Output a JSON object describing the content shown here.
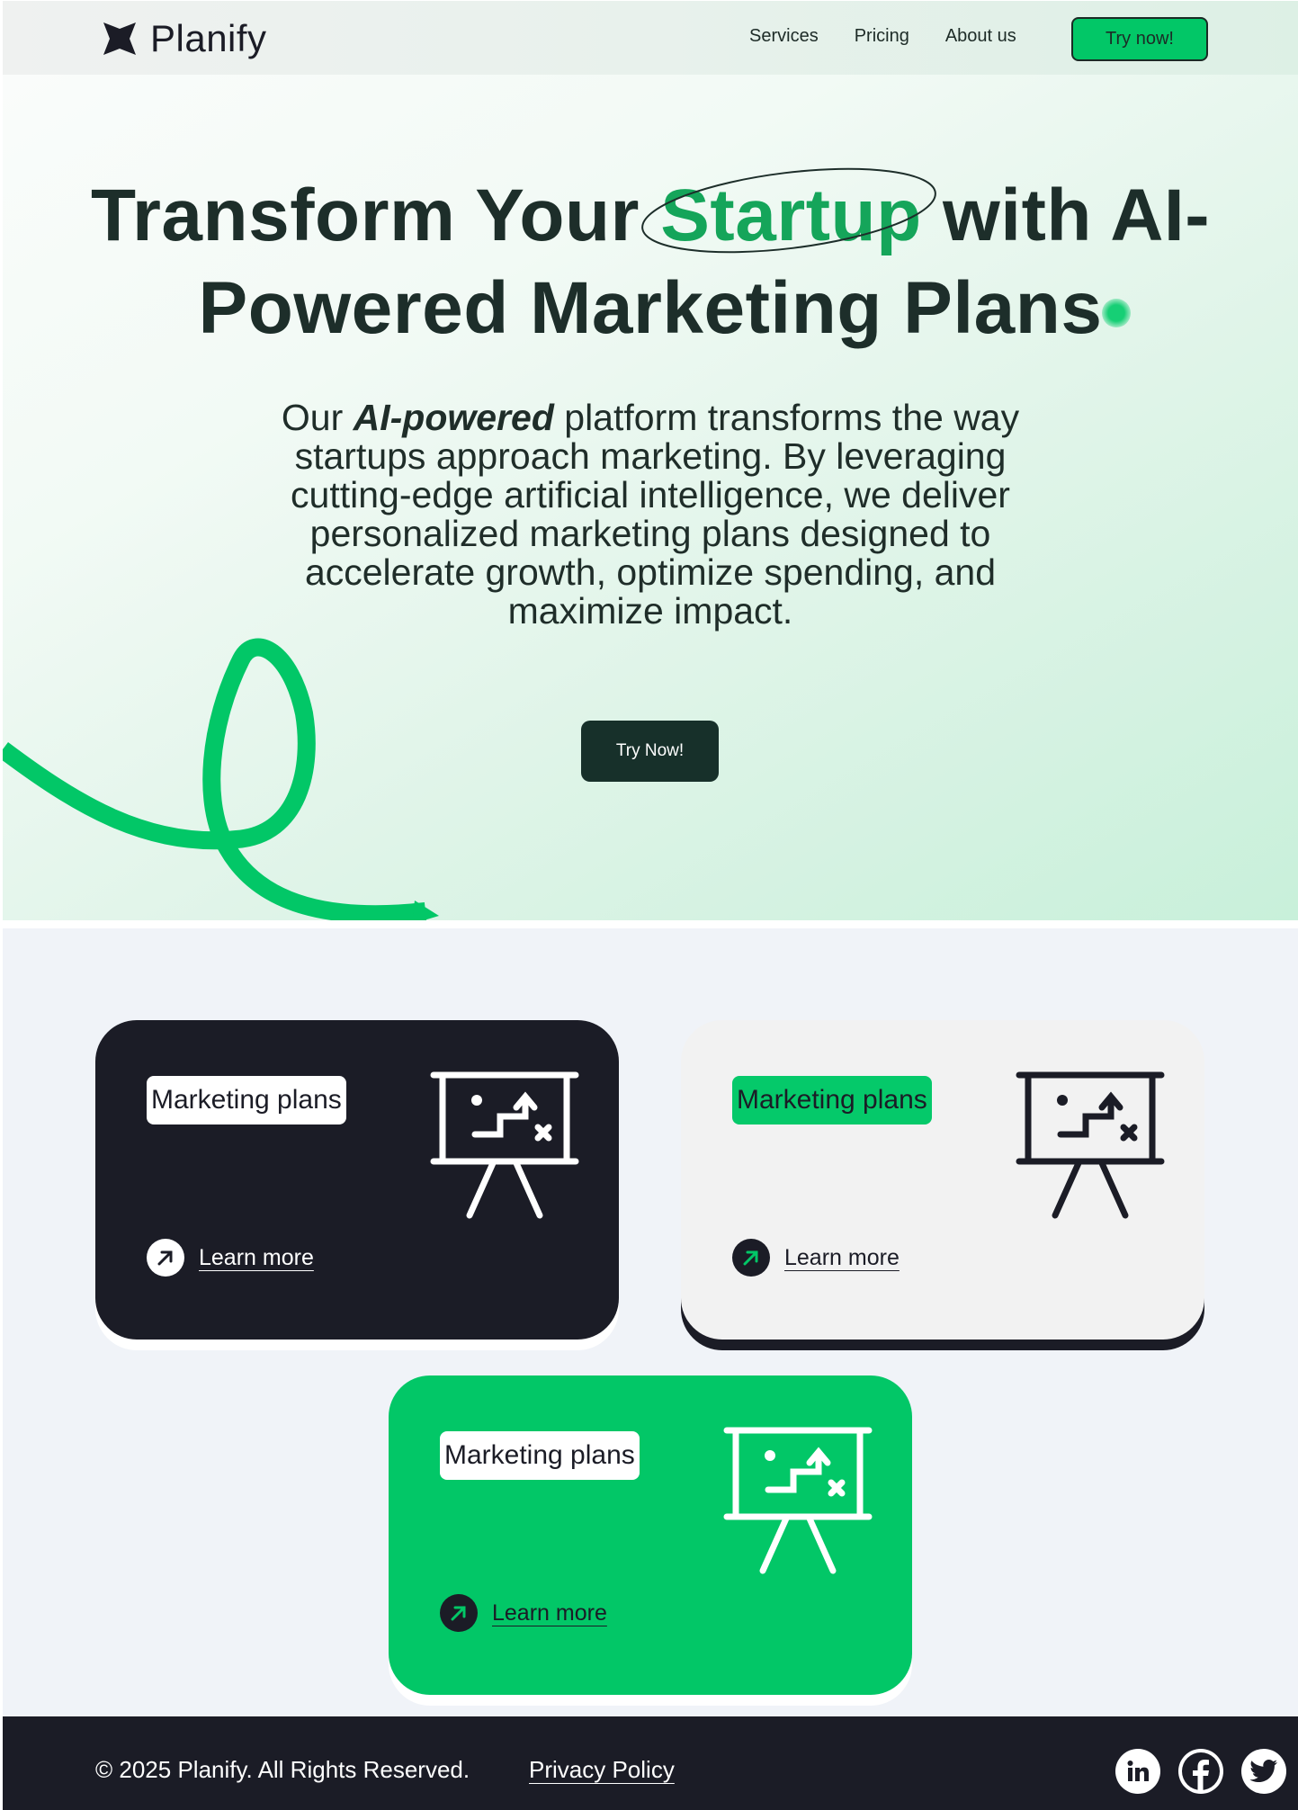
{
  "brand": {
    "name": "Planify",
    "icon": "four-point-star-icon"
  },
  "nav": {
    "links": [
      "Services",
      "Pricing",
      "About us"
    ],
    "cta_label": "Try now!"
  },
  "hero": {
    "title_before": "Transform Your ",
    "title_accent": "Startup",
    "title_after": " with AI-Powered Marketing Plans",
    "desc_before": "Our ",
    "desc_emphasis": "AI-powered",
    "desc_after": " platform transforms the way startups approach marketing. By leveraging cutting-edge artificial intelligence, we deliver personalized marketing plans designed to accelerate growth, optimize spending, and maximize impact.",
    "button_label": "Try Now!"
  },
  "cards": [
    {
      "tag": "Marketing plans",
      "link": "Learn more",
      "icon": "presentation-easel-icon",
      "theme": "dark"
    },
    {
      "tag": "Marketing plans",
      "link": "Learn more",
      "icon": "presentation-easel-icon",
      "theme": "light"
    },
    {
      "tag": "Marketing plans",
      "link": "Learn more",
      "icon": "presentation-easel-icon",
      "theme": "green"
    }
  ],
  "footer": {
    "copyright": "© 2025 Planify. All Rights Reserved.",
    "privacy": "Privacy Policy",
    "socials": [
      "linkedin-icon",
      "facebook-icon",
      "twitter-icon"
    ]
  },
  "colors": {
    "accent_green": "#02c767",
    "dark": "#1b1c26",
    "hero_button": "#17302a"
  }
}
